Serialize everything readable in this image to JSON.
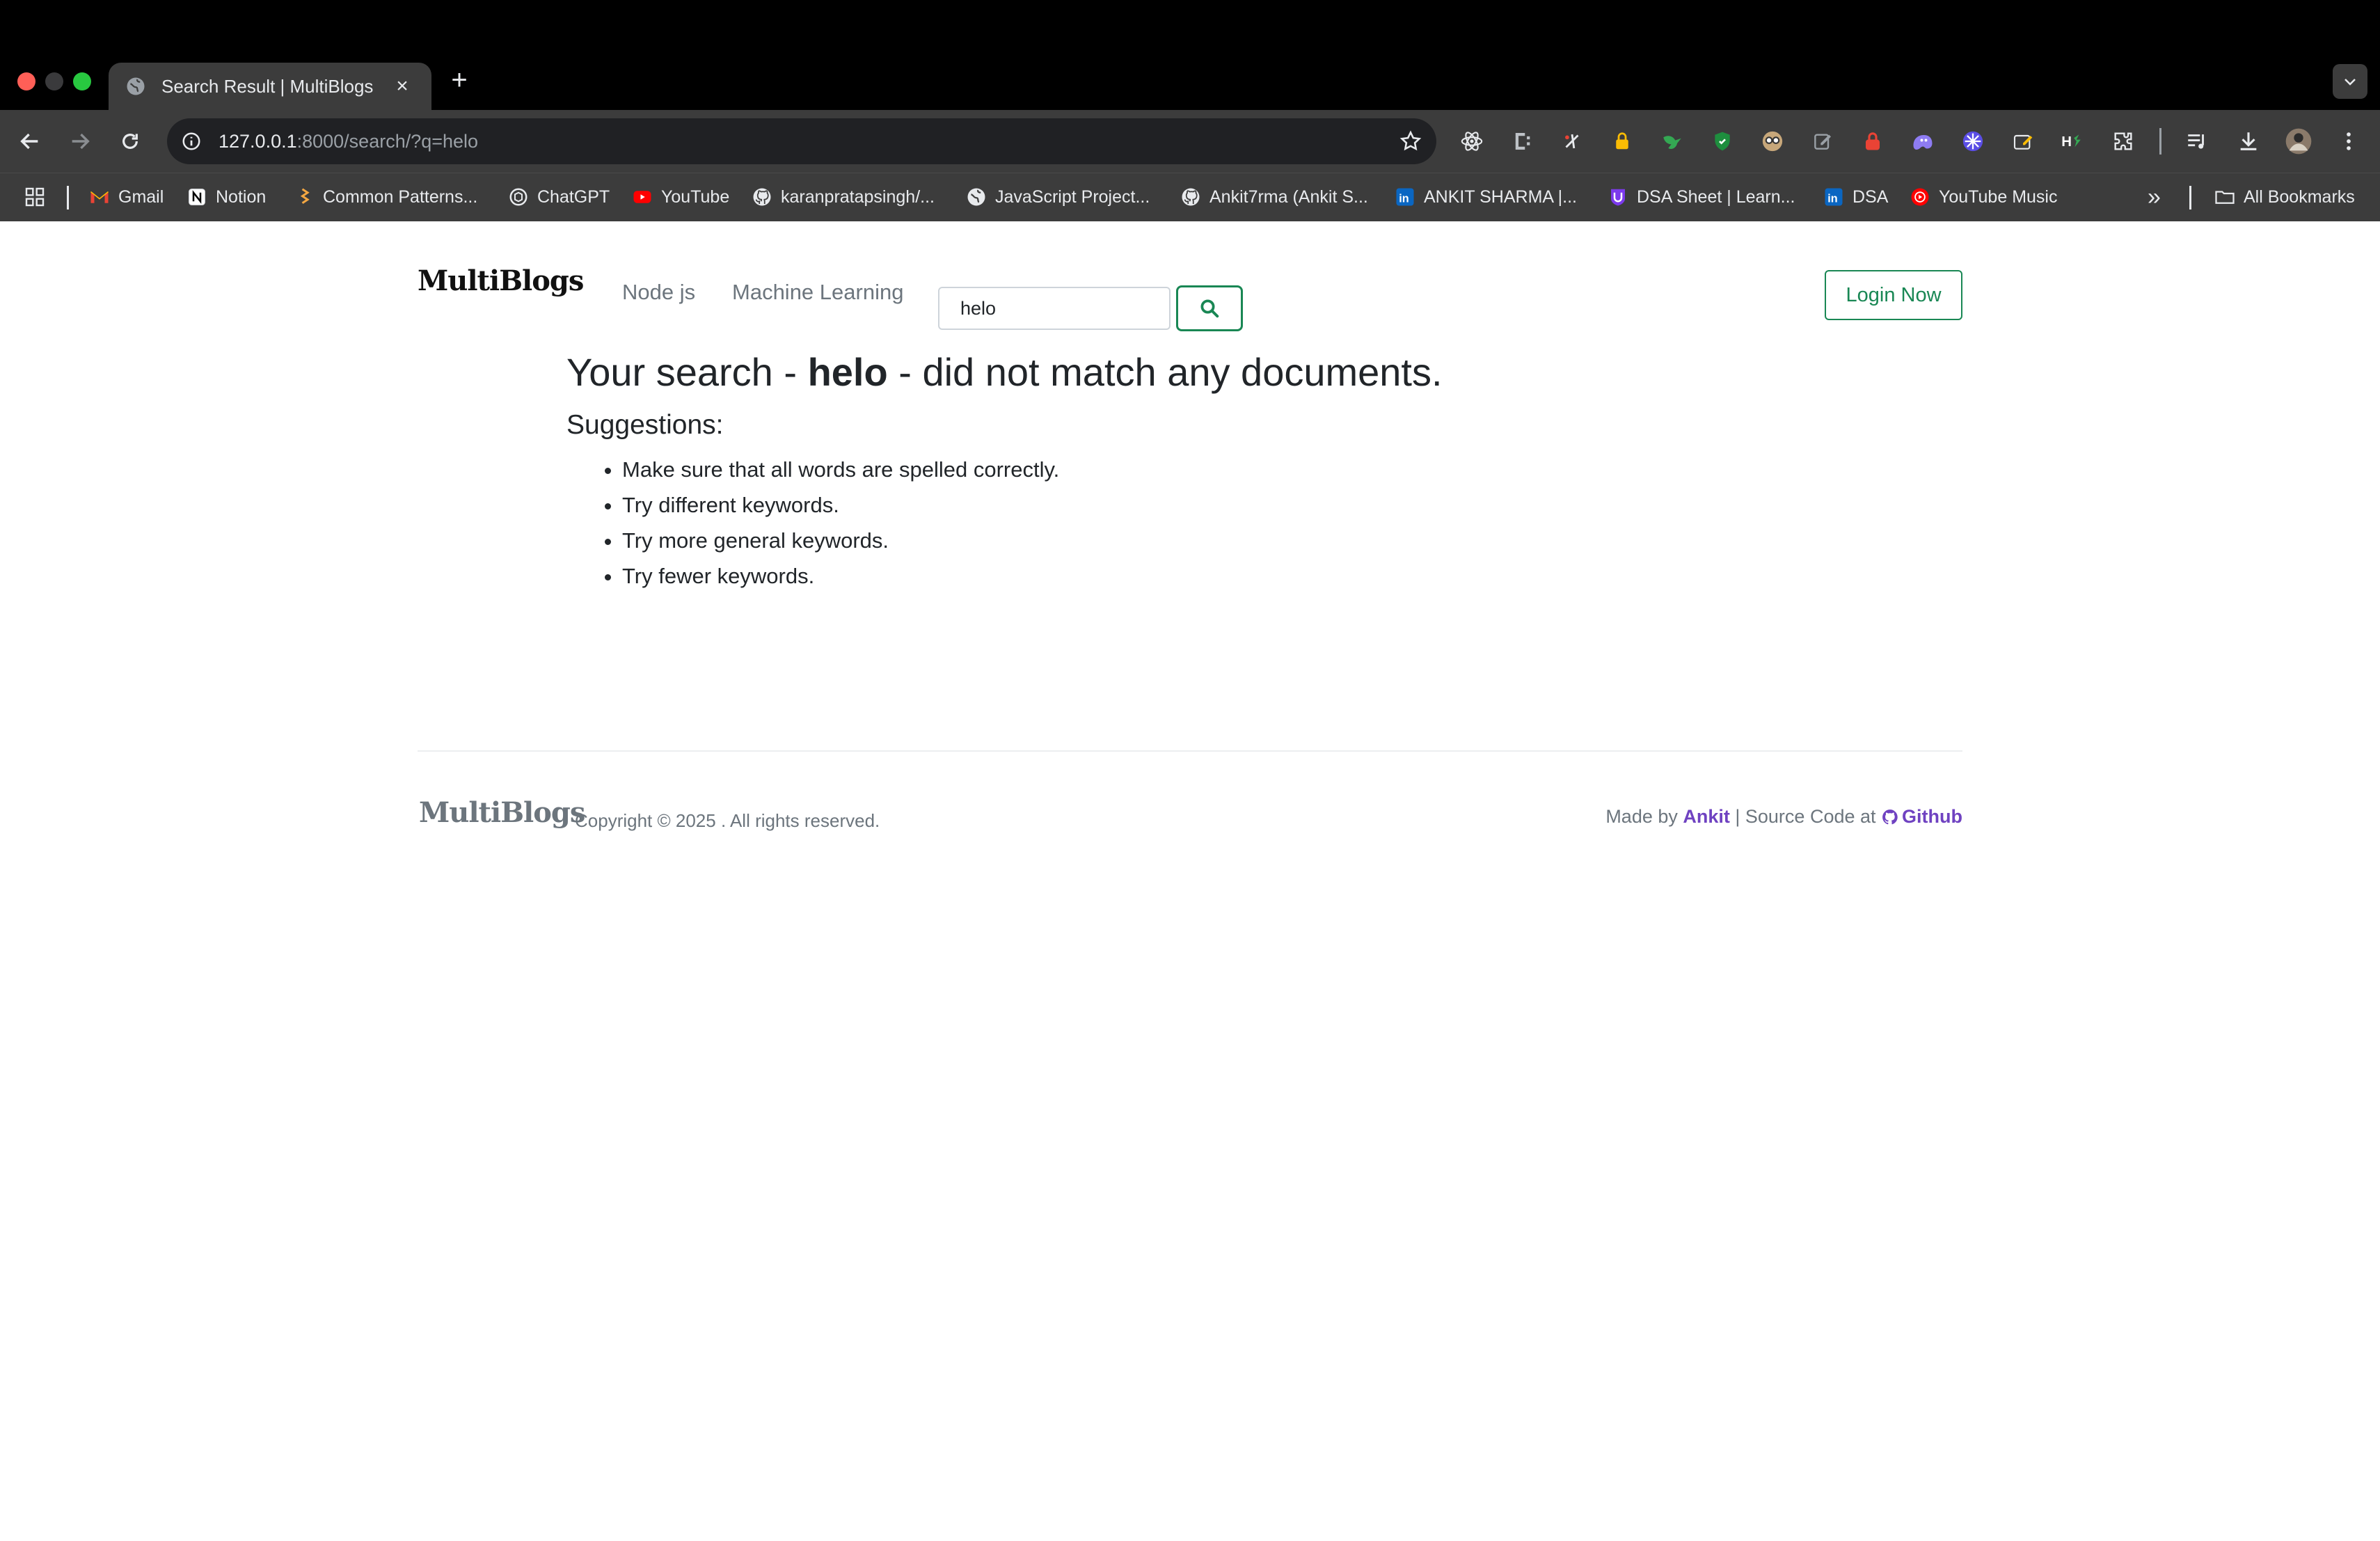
{
  "browser": {
    "tab": {
      "title": "Search Result | MultiBlogs",
      "favicon": "globe-icon",
      "close": "×"
    },
    "new_tab": "+",
    "url": {
      "host": "127.0.0.1",
      "path": ":8000/search/?q=helo"
    },
    "bookmarks": [
      {
        "label": "Gmail",
        "icon": "gmail-icon"
      },
      {
        "label": "Notion",
        "icon": "notion-icon"
      },
      {
        "label": "Common Patterns...",
        "icon": "patterns-icon"
      },
      {
        "label": "ChatGPT",
        "icon": "chatgpt-icon"
      },
      {
        "label": "YouTube",
        "icon": "youtube-icon"
      },
      {
        "label": "karanpratapsingh/...",
        "icon": "github-icon"
      },
      {
        "label": "JavaScript Project...",
        "icon": "globe-icon"
      },
      {
        "label": "Ankit7rma (Ankit S...",
        "icon": "github-icon"
      },
      {
        "label": "ANKIT SHARMA |...",
        "icon": "linkedin-icon"
      },
      {
        "label": "DSA Sheet | Learn...",
        "icon": "dsa-icon"
      },
      {
        "label": "DSA",
        "icon": "linkedin-icon"
      },
      {
        "label": "YouTube Music",
        "icon": "youtube-music-icon"
      }
    ],
    "more_bookmarks": "»",
    "all_bookmarks": "All Bookmarks"
  },
  "site": {
    "brand": "MultiBlogs",
    "nav": [
      "Node js",
      "Machine Learning"
    ],
    "search": {
      "value": "helo"
    },
    "login_label": "Login Now"
  },
  "results": {
    "prefix": "Your search - ",
    "query": "helo",
    "suffix": " - did not match any documents.",
    "suggestions_heading": "Suggestions:",
    "suggestions": [
      "Make sure that all words are spelled correctly.",
      "Try different keywords.",
      "Try more general keywords.",
      "Try fewer keywords."
    ]
  },
  "footer": {
    "brand": "MultiBlogs",
    "copyright": "Copyright © 2025 . All rights reserved.",
    "made_by": "Made by ",
    "author": "Ankit",
    "source_text": " | Source Code at ",
    "github": "Github"
  },
  "colors": {
    "accent": "#198754",
    "link": "#6f42c1",
    "muted": "#6c757d"
  }
}
